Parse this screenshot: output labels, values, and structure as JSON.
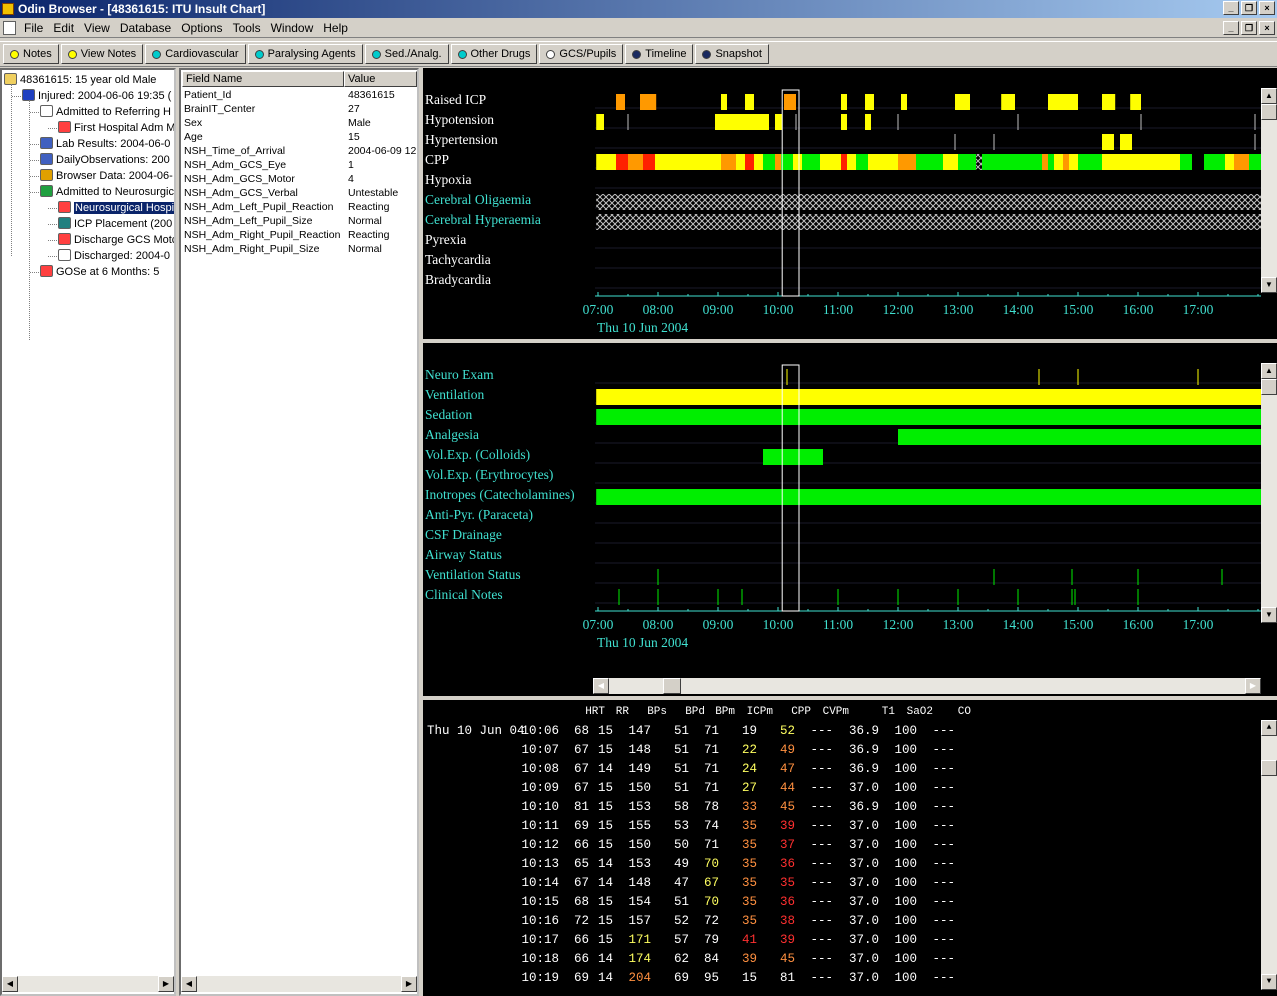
{
  "window": {
    "title": "Odin Browser - [48361615:  ITU Insult Chart]"
  },
  "menu": [
    "File",
    "Edit",
    "View",
    "Database",
    "Options",
    "Tools",
    "Window",
    "Help"
  ],
  "toolbar": [
    {
      "label": "Notes",
      "color": "#ffff00",
      "icon": "circle-icon"
    },
    {
      "label": "View Notes",
      "color": "#ffff00",
      "icon": "circle-icon"
    },
    {
      "label": "Cardiovascular",
      "color": "#00cccc",
      "icon": "circle-icon"
    },
    {
      "label": "Paralysing Agents",
      "color": "#00cccc",
      "icon": "circle-icon"
    },
    {
      "label": "Sed./Analg.",
      "color": "#00cccc",
      "icon": "circle-icon"
    },
    {
      "label": "Other Drugs",
      "color": "#00cccc",
      "icon": "circle-icon"
    },
    {
      "label": "GCS/Pupils",
      "color": "#ffffff",
      "icon": "circle-icon"
    },
    {
      "label": "Timeline",
      "color": "#1a2a60",
      "icon": "circle-icon"
    },
    {
      "label": "Snapshot",
      "color": "#1a2a60",
      "icon": "circle-icon"
    }
  ],
  "tree": [
    {
      "label": "48361615: 15 year old Male",
      "indent": 0,
      "icon": "folder-icon",
      "color": "#f0d060"
    },
    {
      "label": "Injured: 2004-06-06 19:35 (",
      "indent": 1,
      "icon": "asterisk-icon",
      "color": "#2040c0"
    },
    {
      "label": "Admitted to Referring H",
      "indent": 2,
      "icon": "hand-icon",
      "color": "#ffffff"
    },
    {
      "label": "First Hospital Adm M",
      "indent": 3,
      "icon": "stethoscope-icon",
      "color": "#ff4040"
    },
    {
      "label": "Lab Results: 2004-06-0",
      "indent": 2,
      "icon": "grid-icon",
      "color": "#4060c0"
    },
    {
      "label": "DailyObservations: 200",
      "indent": 2,
      "icon": "grid-icon",
      "color": "#4060c0"
    },
    {
      "label": "Browser Data: 2004-06-",
      "indent": 2,
      "icon": "chart-icon",
      "color": "#e0a000"
    },
    {
      "label": "Admitted to Neurosurgic",
      "indent": 2,
      "icon": "bed-icon",
      "color": "#20a040"
    },
    {
      "label": "Neurosurgical Hospi",
      "indent": 3,
      "icon": "stethoscope-icon",
      "color": "#ff4040",
      "selected": true
    },
    {
      "label": "ICP Placement (200",
      "indent": 3,
      "icon": "probe-icon",
      "color": "#208080"
    },
    {
      "label": "Discharge GCS Motc",
      "indent": 3,
      "icon": "stethoscope-icon",
      "color": "#ff4040"
    },
    {
      "label": "Discharged: 2004-0",
      "indent": 3,
      "icon": "hand-icon",
      "color": "#ffffff"
    },
    {
      "label": "GOSe at 6 Months: 5",
      "indent": 2,
      "icon": "stethoscope-icon",
      "color": "#ff4040"
    }
  ],
  "fields": {
    "header": {
      "name": "Field Name",
      "value": "Value"
    },
    "rows": [
      {
        "name": "Patient_Id",
        "value": "48361615"
      },
      {
        "name": "BrainIT_Center",
        "value": "27"
      },
      {
        "name": "Sex",
        "value": "Male"
      },
      {
        "name": "Age",
        "value": "15"
      },
      {
        "name": "NSH_Time_of_Arrival",
        "value": "2004-06-09 12"
      },
      {
        "name": "NSH_Adm_GCS_Eye",
        "value": "1"
      },
      {
        "name": "NSH_Adm_GCS_Motor",
        "value": "4"
      },
      {
        "name": "NSH_Adm_GCS_Verbal",
        "value": "Untestable"
      },
      {
        "name": "NSH_Adm_Left_Pupil_Reaction",
        "value": "Reacting"
      },
      {
        "name": "NSH_Adm_Left_Pupil_Size",
        "value": "Normal"
      },
      {
        "name": "NSH_Adm_Right_Pupil_Reaction",
        "value": "Reacting"
      },
      {
        "name": "NSH_Adm_Right_Pupil_Size",
        "value": "Normal"
      }
    ]
  },
  "colors": {
    "yellow": "#ffff00",
    "orange": "#ff9900",
    "red": "#ff2000",
    "green": "#00ee00",
    "cyan": "#40e0d0"
  },
  "chart_data": [
    {
      "type": "timeline",
      "date": "Thu 10 Jun 2004",
      "x_ticks": [
        "07:00",
        "08:00",
        "09:00",
        "10:00",
        "11:00",
        "12:00",
        "13:00",
        "14:00",
        "15:00",
        "16:00",
        "17:00"
      ],
      "xlim": [
        6.95,
        18.05
      ],
      "selection": [
        10.07,
        10.35
      ],
      "rows": [
        {
          "label": "Raised ICP",
          "color": "white",
          "segments": [
            [
              7.3,
              7.45,
              "orange"
            ],
            [
              7.7,
              7.97,
              "orange"
            ],
            [
              9.05,
              9.15,
              "yellow"
            ],
            [
              9.45,
              9.6,
              "yellow"
            ],
            [
              10.1,
              10.3,
              "orange"
            ],
            [
              11.05,
              11.15,
              "yellow"
            ],
            [
              11.45,
              11.6,
              "yellow"
            ],
            [
              12.05,
              12.15,
              "yellow"
            ],
            [
              12.95,
              13.2,
              "yellow"
            ],
            [
              13.72,
              13.95,
              "yellow"
            ],
            [
              14.5,
              15.0,
              "yellow"
            ],
            [
              15.4,
              15.62,
              "yellow"
            ],
            [
              15.87,
              16.05,
              "yellow"
            ]
          ]
        },
        {
          "label": "Hypotension",
          "color": "white",
          "segments": [
            [
              6.97,
              7.1,
              "yellow"
            ],
            [
              8.95,
              9.85,
              "yellow"
            ],
            [
              9.95,
              10.07,
              "yellow"
            ],
            [
              11.05,
              11.15,
              "yellow"
            ],
            [
              11.45,
              11.55,
              "yellow"
            ]
          ],
          "ticks": [
            7.5,
            10.3,
            12.0,
            14.0,
            16.05,
            17.95
          ]
        },
        {
          "label": "Hypertension",
          "color": "white",
          "segments": [
            [
              15.4,
              15.6,
              "yellow"
            ],
            [
              15.7,
              15.9,
              "yellow"
            ]
          ],
          "ticks": [
            12.95,
            13.6,
            17.95
          ]
        },
        {
          "label": "CPP",
          "color": "white",
          "segments": [
            [
              6.97,
              7.3,
              "yellow"
            ],
            [
              7.3,
              7.5,
              "red"
            ],
            [
              7.5,
              7.75,
              "orange"
            ],
            [
              7.75,
              7.95,
              "red"
            ],
            [
              7.95,
              9.05,
              "yellow"
            ],
            [
              9.05,
              9.3,
              "orange"
            ],
            [
              9.3,
              9.45,
              "yellow"
            ],
            [
              9.45,
              9.6,
              "red"
            ],
            [
              9.6,
              9.75,
              "yellow"
            ],
            [
              9.75,
              9.95,
              "green"
            ],
            [
              9.95,
              10.05,
              "orange"
            ],
            [
              10.05,
              10.25,
              "green"
            ],
            [
              10.25,
              10.4,
              "yellow"
            ],
            [
              10.4,
              10.7,
              "green"
            ],
            [
              10.7,
              11.05,
              "yellow"
            ],
            [
              11.05,
              11.15,
              "red"
            ],
            [
              11.15,
              11.3,
              "yellow"
            ],
            [
              11.3,
              11.5,
              "green"
            ],
            [
              11.5,
              12.0,
              "yellow"
            ],
            [
              12.0,
              12.3,
              "orange"
            ],
            [
              12.3,
              12.75,
              "green"
            ],
            [
              12.75,
              13.0,
              "yellow"
            ],
            [
              13.0,
              13.3,
              "green"
            ],
            [
              13.4,
              14.4,
              "green"
            ],
            [
              14.4,
              14.5,
              "orange"
            ],
            [
              14.5,
              14.6,
              "green"
            ],
            [
              14.6,
              14.75,
              "yellow"
            ],
            [
              14.75,
              14.85,
              "orange"
            ],
            [
              14.85,
              15.0,
              "yellow"
            ],
            [
              15.0,
              15.4,
              "green"
            ],
            [
              15.4,
              16.7,
              "yellow"
            ],
            [
              16.7,
              16.9,
              "green"
            ],
            [
              16.9,
              17.1,
              "white"
            ],
            [
              17.1,
              17.45,
              "green"
            ],
            [
              17.45,
              17.6,
              "yellow"
            ],
            [
              17.6,
              17.85,
              "orange"
            ],
            [
              17.85,
              18.05,
              "green"
            ]
          ],
          "hatch": [
            [
              13.3,
              13.4
            ]
          ]
        },
        {
          "label": "Hypoxia",
          "color": "white",
          "segments": []
        },
        {
          "label": "Cerebral Oligaemia",
          "color": "cyan",
          "hatch": [
            [
              6.97,
              18.05
            ]
          ]
        },
        {
          "label": "Cerebral Hyperaemia",
          "color": "cyan",
          "hatch": [
            [
              6.97,
              18.05
            ]
          ]
        },
        {
          "label": "Pyrexia",
          "color": "white",
          "segments": []
        },
        {
          "label": "Tachycardia",
          "color": "white",
          "segments": []
        },
        {
          "label": "Bradycardia",
          "color": "white",
          "segments": []
        }
      ]
    },
    {
      "type": "timeline",
      "date": "Thu 10 Jun 2004",
      "x_ticks": [
        "07:00",
        "08:00",
        "09:00",
        "10:00",
        "11:00",
        "12:00",
        "13:00",
        "14:00",
        "15:00",
        "16:00",
        "17:00"
      ],
      "xlim": [
        6.95,
        18.05
      ],
      "selection": [
        10.07,
        10.35
      ],
      "rows": [
        {
          "label": "Neuro Exam",
          "ticks": [
            10.15,
            14.35,
            15.0,
            17.0
          ]
        },
        {
          "label": "Ventilation",
          "segments": [
            [
              6.97,
              18.05,
              "yellow"
            ]
          ]
        },
        {
          "label": "Sedation",
          "segments": [
            [
              6.97,
              18.05,
              "green"
            ]
          ]
        },
        {
          "label": "Analgesia",
          "segments": [
            [
              12.0,
              18.05,
              "green"
            ]
          ]
        },
        {
          "label": "Vol.Exp. (Colloids)",
          "segments": [
            [
              9.75,
              10.75,
              "green"
            ]
          ]
        },
        {
          "label": "Vol.Exp. (Erythrocytes)",
          "segments": []
        },
        {
          "label": "Inotropes (Catecholamines)",
          "segments": [
            [
              6.97,
              18.05,
              "green"
            ]
          ]
        },
        {
          "label": "Anti-Pyr. (Paraceta)",
          "segments": []
        },
        {
          "label": "CSF Drainage",
          "segments": []
        },
        {
          "label": "Airway Status",
          "segments": []
        },
        {
          "label": "Ventilation Status",
          "ticks": [
            8.0,
            13.6,
            14.9,
            16.0,
            17.4
          ]
        },
        {
          "label": "Clinical Notes",
          "ticks": [
            7.35,
            8.0,
            9.0,
            9.4,
            11.0,
            12.0,
            13.0,
            14.0,
            14.9,
            14.95,
            16.0
          ]
        }
      ]
    },
    {
      "type": "table",
      "date": "Thu 10 Jun 04",
      "columns": [
        "HRT",
        "RR",
        "BPs",
        "BPd",
        "BPm",
        "ICPm",
        "CPP",
        "CVPm",
        "T1",
        "SaO2",
        "CO"
      ],
      "rows": [
        {
          "time": "10:06",
          "v": [
            "68",
            "15",
            "147",
            "51",
            "71",
            "19",
            "52",
            "---",
            "36.9",
            "100",
            "---"
          ],
          "c": {
            "CPP": "#ffff60"
          }
        },
        {
          "time": "10:07",
          "v": [
            "67",
            "15",
            "148",
            "51",
            "71",
            "22",
            "49",
            "---",
            "36.9",
            "100",
            "---"
          ],
          "c": {
            "ICPm": "#ffff60",
            "CPP": "#ff9040"
          }
        },
        {
          "time": "10:08",
          "v": [
            "67",
            "14",
            "149",
            "51",
            "71",
            "24",
            "47",
            "---",
            "36.9",
            "100",
            "---"
          ],
          "c": {
            "ICPm": "#ffff60",
            "CPP": "#ff9040"
          }
        },
        {
          "time": "10:09",
          "v": [
            "67",
            "15",
            "150",
            "51",
            "71",
            "27",
            "44",
            "---",
            "37.0",
            "100",
            "---"
          ],
          "c": {
            "ICPm": "#ffff60",
            "CPP": "#ff9040"
          }
        },
        {
          "time": "10:10",
          "v": [
            "81",
            "15",
            "153",
            "58",
            "78",
            "33",
            "45",
            "---",
            "36.9",
            "100",
            "---"
          ],
          "c": {
            "ICPm": "#ff9040",
            "CPP": "#ff9040"
          }
        },
        {
          "time": "10:11",
          "v": [
            "69",
            "15",
            "155",
            "53",
            "74",
            "35",
            "39",
            "---",
            "37.0",
            "100",
            "---"
          ],
          "c": {
            "ICPm": "#ff9040",
            "CPP": "#ff3030"
          }
        },
        {
          "time": "10:12",
          "v": [
            "66",
            "15",
            "150",
            "50",
            "71",
            "35",
            "37",
            "---",
            "37.0",
            "100",
            "---"
          ],
          "c": {
            "ICPm": "#ff9040",
            "CPP": "#ff3030"
          }
        },
        {
          "time": "10:13",
          "v": [
            "65",
            "14",
            "153",
            "49",
            "70",
            "35",
            "36",
            "---",
            "37.0",
            "100",
            "---"
          ],
          "c": {
            "BPm": "#ffff60",
            "ICPm": "#ff9040",
            "CPP": "#ff3030"
          }
        },
        {
          "time": "10:14",
          "v": [
            "67",
            "14",
            "148",
            "47",
            "67",
            "35",
            "35",
            "---",
            "37.0",
            "100",
            "---"
          ],
          "c": {
            "BPm": "#ffff60",
            "ICPm": "#ff9040",
            "CPP": "#ff3030"
          }
        },
        {
          "time": "10:15",
          "v": [
            "68",
            "15",
            "154",
            "51",
            "70",
            "35",
            "36",
            "---",
            "37.0",
            "100",
            "---"
          ],
          "c": {
            "BPm": "#ffff60",
            "ICPm": "#ff9040",
            "CPP": "#ff3030"
          }
        },
        {
          "time": "10:16",
          "v": [
            "72",
            "15",
            "157",
            "52",
            "72",
            "35",
            "38",
            "---",
            "37.0",
            "100",
            "---"
          ],
          "c": {
            "ICPm": "#ff9040",
            "CPP": "#ff3030"
          }
        },
        {
          "time": "10:17",
          "v": [
            "66",
            "15",
            "171",
            "57",
            "79",
            "41",
            "39",
            "---",
            "37.0",
            "100",
            "---"
          ],
          "c": {
            "BPs": "#ffff60",
            "ICPm": "#ff3030",
            "CPP": "#ff3030"
          }
        },
        {
          "time": "10:18",
          "v": [
            "66",
            "14",
            "174",
            "62",
            "84",
            "39",
            "45",
            "---",
            "37.0",
            "100",
            "---"
          ],
          "c": {
            "BPs": "#ffff60",
            "ICPm": "#ff9040",
            "CPP": "#ff9040"
          }
        },
        {
          "time": "10:19",
          "v": [
            "69",
            "14",
            "204",
            "69",
            "95",
            "15",
            "81",
            "---",
            "37.0",
            "100",
            "---"
          ],
          "c": {
            "BPs": "#ff9040"
          }
        }
      ]
    }
  ]
}
